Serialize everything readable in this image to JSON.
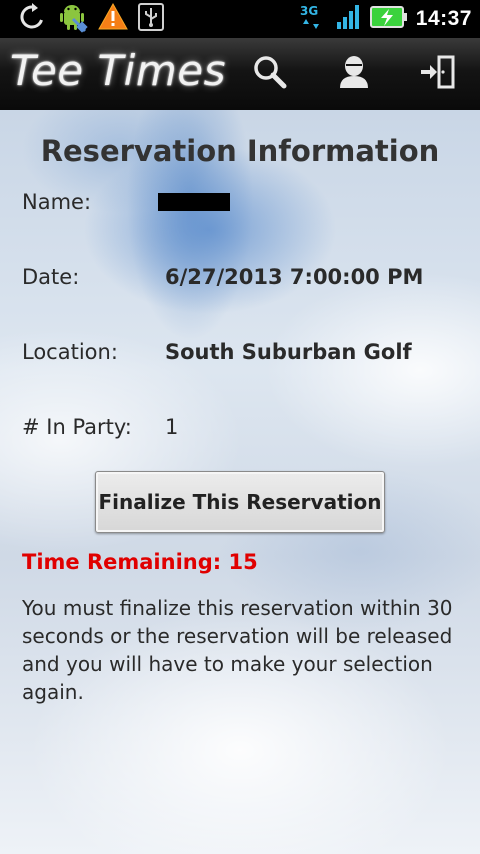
{
  "status_bar": {
    "network_type": "3G",
    "time": "14:37",
    "icons": [
      "sync-icon",
      "android-debug-icon",
      "warning-icon",
      "usb-icon",
      "signal-icon",
      "battery-charging-icon"
    ]
  },
  "action_bar": {
    "title": "Tee Times",
    "actions": [
      "search-icon",
      "account-icon",
      "logout-icon"
    ]
  },
  "main": {
    "heading": "Reservation Information",
    "fields": {
      "name_label": "Name:",
      "date_label": "Date:",
      "date_value": "6/27/2013 7:00:00 PM",
      "location_label": "Location:",
      "location_value": "South Suburban Golf",
      "party_label": "# In Party:",
      "party_value": "1"
    },
    "finalize_button": "Finalize This Reservation",
    "time_remaining": "Time Remaining: 15",
    "notice": "You must finalize this reservation within 30 seconds or the reservation will be released and you will have to make your selection again."
  },
  "colors": {
    "warning_text": "#e00000",
    "action_bar_bg": "#141414",
    "status_green": "#3bd23d",
    "network_blue": "#33b5e5"
  }
}
